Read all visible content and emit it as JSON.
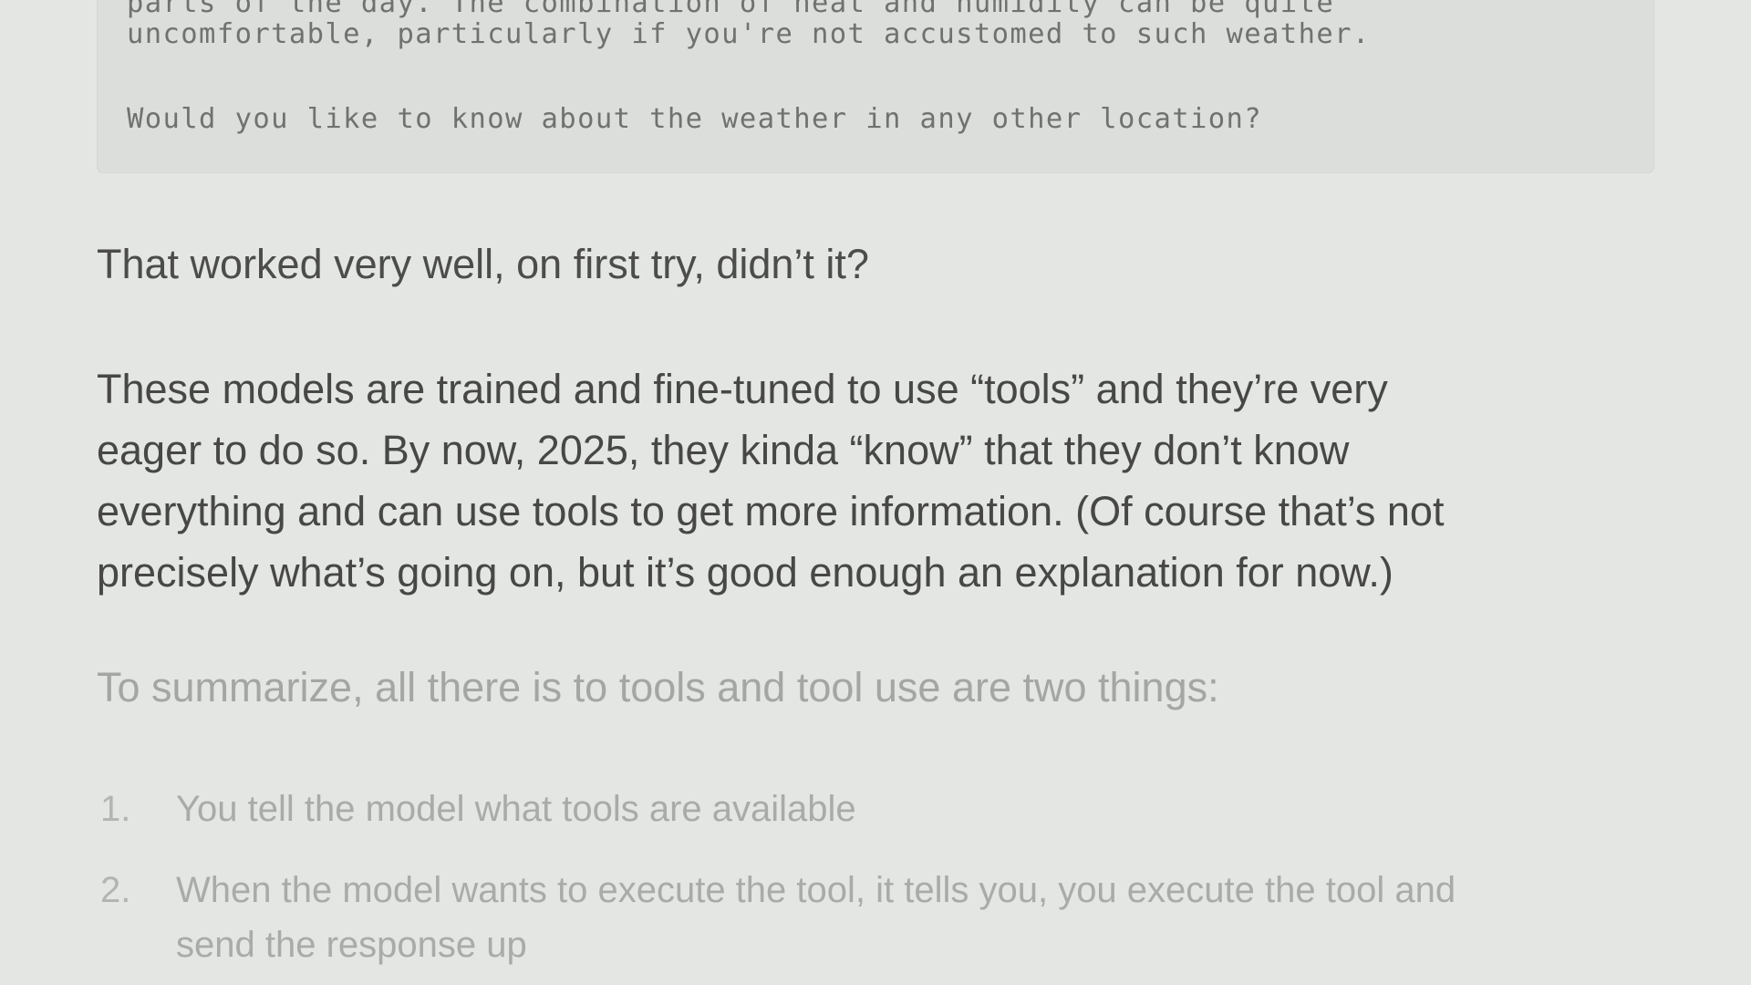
{
  "code_block": {
    "lines": [
      "parts of the day. The combination of heat and humidity can be quite",
      "uncomfortable, particularly if you're not accustomed to such weather.",
      "",
      "Would you like to know about the weather in any other location?"
    ]
  },
  "content": {
    "paragraph_1": "That worked very well, on first try, didn’t it?",
    "paragraph_2_lines": [
      "These models are trained and fine-tuned to use “tools” and they’re very",
      "eager to do so. By now, 2025, they kinda “know” that they don’t know",
      "everything and can use tools to get more information. (Of course that’s not",
      "precisely what’s going on, but it’s good enough an explanation for now.)"
    ],
    "paragraph_3": "To summarize, all there is to tools and tool use are two things:",
    "list": [
      {
        "number": "1.",
        "lines": [
          "You tell the model what tools are available"
        ]
      },
      {
        "number": "2.",
        "lines": [
          "When the model wants to execute the tool, it tells you, you execute the tool and",
          "send the response up"
        ]
      }
    ]
  }
}
